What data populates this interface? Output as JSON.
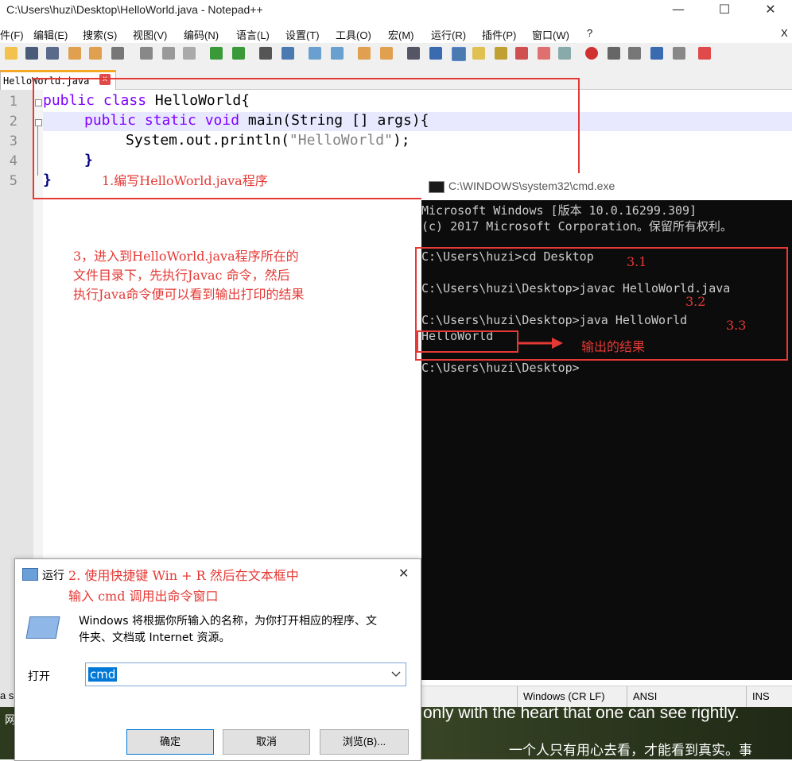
{
  "notepad": {
    "title": "C:\\Users\\huzi\\Desktop\\HelloWorld.java - Notepad++",
    "win_min": "—",
    "win_max": "☐",
    "win_close": "✕",
    "menu": [
      "件(F)",
      "编辑(E)",
      "搜索(S)",
      "视图(V)",
      "编码(N)",
      "语言(L)",
      "设置(T)",
      "工具(O)",
      "宏(M)",
      "运行(R)",
      "插件(P)",
      "窗口(W)",
      "?"
    ],
    "menu_close": "X",
    "tab_label": "HelloWorld.java",
    "tab_close": "x",
    "line_numbers": [
      "1",
      "2",
      "3",
      "4",
      "5"
    ],
    "code": {
      "l1_kw": "public class",
      "l1_rest": " HelloWorld{",
      "l2_kw": "public static void",
      "l2_rest": " main(String [] args){",
      "l3_a": "System.out.println(",
      "l3_str": "\"HelloWorld\"",
      "l3_b": ");",
      "l4": "}",
      "l5": "}"
    },
    "status_segments": [
      "Windows (CR LF)",
      "ANSI",
      "INS"
    ]
  },
  "annotations": {
    "step1": "1.编写HelloWorld.java程序",
    "step3_lines": [
      "3，进入到HelloWorld.java程序所在的",
      "文件目录下，先执行Javac 命令，然后",
      "执行Java命令便可以看到输出打印的结果"
    ],
    "step31": "3.1",
    "step32": "3.2",
    "step33": "3.3",
    "output_label": "输出的结果",
    "step2_lines": [
      "2. 使用快捷键 Win + R 然后在文本框中",
      "输入 cmd 调用出命令窗口"
    ]
  },
  "cmd": {
    "title": "C:\\WINDOWS\\system32\\cmd.exe",
    "lines": [
      "Microsoft Windows [版本 10.0.16299.309]",
      "(c) 2017 Microsoft Corporation。保留所有权利。",
      "C:\\Users\\huzi>cd Desktop",
      "C:\\Users\\huzi\\Desktop>javac HelloWorld.java",
      "C:\\Users\\huzi\\Desktop>java HelloWorld",
      "HelloWorld",
      "C:\\Users\\huzi\\Desktop>"
    ]
  },
  "run_dialog": {
    "title": "运行",
    "close": "✕",
    "description_lines": [
      "Windows 将根据你所输入的名称，为你打开相应的程序、文",
      "件夹、文档或 Internet 资源。"
    ],
    "open_label": "打开",
    "input_value": "cmd",
    "ok": "确定",
    "cancel": "取消",
    "browse": "浏览(B)..."
  },
  "desktop": {
    "caption_en": "only with the heart that one can see rightly.",
    "caption_zh": "一个人只有用心去看，才能看到真实。事",
    "left_fragment_1": "a s",
    "left_fragment_2": "网"
  },
  "colors": {
    "annotation": "#e53935",
    "keyword": "#8000ff",
    "string": "#808080",
    "tab_accent": "#f5a623"
  }
}
